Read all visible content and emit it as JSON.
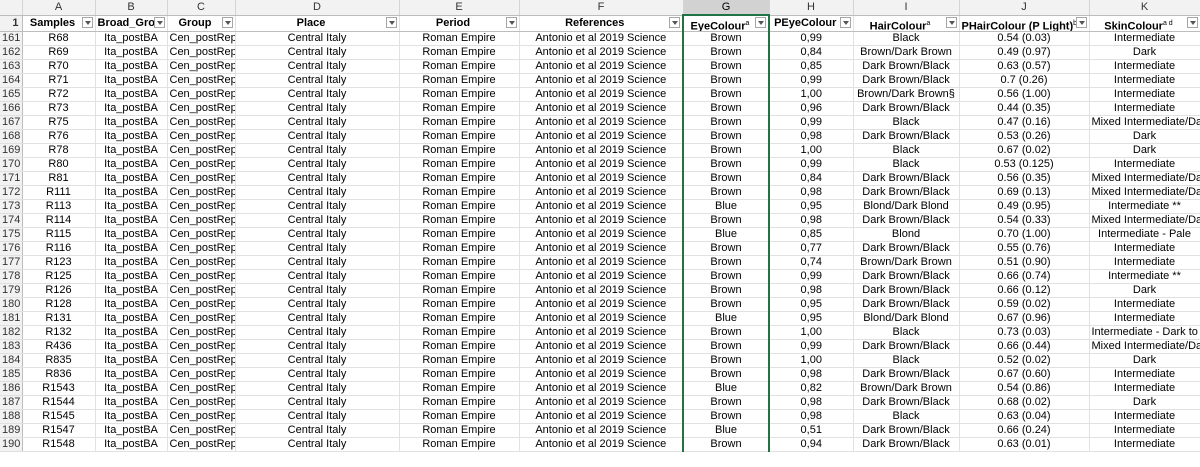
{
  "columns": [
    "A",
    "B",
    "C",
    "D",
    "E",
    "F",
    "G",
    "H",
    "I",
    "J",
    "K"
  ],
  "headers": [
    "Samples",
    "Broad_Gro",
    "Group",
    "Place",
    "Period",
    "References",
    "EyeColour",
    "PEyeColour",
    "HairColour",
    "PHairColour (P Light)",
    "SkinColour"
  ],
  "header_superscripts": [
    "",
    "",
    "",
    "",
    "",
    "",
    "a",
    "",
    "a",
    "b",
    "a d"
  ],
  "header_row_number": "1",
  "rows": [
    [
      "161",
      "R68",
      "Ita_postBA",
      "Cen_postRep",
      "Central Italy",
      "Roman Empire",
      "Antonio et al 2019 Science",
      "Brown",
      "0,99",
      "Black",
      "0.54 (0.03)",
      "Intermediate"
    ],
    [
      "162",
      "R69",
      "Ita_postBA",
      "Cen_postRep",
      "Central Italy",
      "Roman Empire",
      "Antonio et al 2019 Science",
      "Brown",
      "0,84",
      "Brown/Dark Brown",
      "0.49 (0.97)",
      "Dark"
    ],
    [
      "163",
      "R70",
      "Ita_postBA",
      "Cen_postRep",
      "Central Italy",
      "Roman Empire",
      "Antonio et al 2019 Science",
      "Brown",
      "0,85",
      "Dark Brown/Black",
      "0.63 (0.57)",
      "Intermediate"
    ],
    [
      "164",
      "R71",
      "Ita_postBA",
      "Cen_postRep",
      "Central Italy",
      "Roman Empire",
      "Antonio et al 2019 Science",
      "Brown",
      "0,99",
      "Dark Brown/Black",
      "0.7 (0.26)",
      "Intermediate"
    ],
    [
      "165",
      "R72",
      "Ita_postBA",
      "Cen_postRep",
      "Central Italy",
      "Roman Empire",
      "Antonio et al 2019 Science",
      "Brown",
      "1,00",
      "Brown/Dark Brown§",
      "0.56 (1.00)",
      "Intermediate"
    ],
    [
      "166",
      "R73",
      "Ita_postBA",
      "Cen_postRep",
      "Central Italy",
      "Roman Empire",
      "Antonio et al 2019 Science",
      "Brown",
      "0,96",
      "Dark Brown/Black",
      "0.44 (0.35)",
      "Intermediate"
    ],
    [
      "167",
      "R75",
      "Ita_postBA",
      "Cen_postRep",
      "Central Italy",
      "Roman Empire",
      "Antonio et al 2019 Science",
      "Brown",
      "0,99",
      "Black",
      "0.47 (0.16)",
      "Mixed Intermediate/Dark"
    ],
    [
      "168",
      "R76",
      "Ita_postBA",
      "Cen_postRep",
      "Central Italy",
      "Roman Empire",
      "Antonio et al 2019 Science",
      "Brown",
      "0,98",
      "Dark Brown/Black",
      "0.53 (0.26)",
      "Dark"
    ],
    [
      "169",
      "R78",
      "Ita_postBA",
      "Cen_postRep",
      "Central Italy",
      "Roman Empire",
      "Antonio et al 2019 Science",
      "Brown",
      "1,00",
      "Black",
      "0.67 (0.02)",
      "Dark"
    ],
    [
      "170",
      "R80",
      "Ita_postBA",
      "Cen_postRep",
      "Central Italy",
      "Roman Empire",
      "Antonio et al 2019 Science",
      "Brown",
      "0,99",
      "Black",
      "0.53 (0.125)",
      "Intermediate"
    ],
    [
      "171",
      "R81",
      "Ita_postBA",
      "Cen_postRep",
      "Central Italy",
      "Roman Empire",
      "Antonio et al 2019 Science",
      "Brown",
      "0,84",
      "Dark Brown/Black",
      "0.56 (0.35)",
      "Mixed Intermediate/Dark"
    ],
    [
      "172",
      "R111",
      "Ita_postBA",
      "Cen_postRep",
      "Central Italy",
      "Roman Empire",
      "Antonio et al 2019 Science",
      "Brown",
      "0,98",
      "Dark Brown/Black",
      "0.69 (0.13)",
      "Mixed Intermediate/Dark"
    ],
    [
      "173",
      "R113",
      "Ita_postBA",
      "Cen_postRep",
      "Central Italy",
      "Roman Empire",
      "Antonio et al 2019 Science",
      "Blue",
      "0,95",
      "Blond/Dark Blond",
      "0.49 (0.95)",
      "Intermediate **"
    ],
    [
      "174",
      "R114",
      "Ita_postBA",
      "Cen_postRep",
      "Central Italy",
      "Roman Empire",
      "Antonio et al 2019 Science",
      "Brown",
      "0,98",
      "Dark Brown/Black",
      "0.54 (0.33)",
      "Mixed Intermediate/Dark"
    ],
    [
      "175",
      "R115",
      "Ita_postBA",
      "Cen_postRep",
      "Central Italy",
      "Roman Empire",
      "Antonio et al 2019 Science",
      "Blue",
      "0,85",
      "Blond",
      "0.70 (1.00)",
      "Intermediate - Pale"
    ],
    [
      "176",
      "R116",
      "Ita_postBA",
      "Cen_postRep",
      "Central Italy",
      "Roman Empire",
      "Antonio et al 2019 Science",
      "Brown",
      "0,77",
      "Dark Brown/Black",
      "0.55 (0.76)",
      "Intermediate"
    ],
    [
      "177",
      "R123",
      "Ita_postBA",
      "Cen_postRep",
      "Central Italy",
      "Roman Empire",
      "Antonio et al 2019 Science",
      "Brown",
      "0,74",
      "Brown/Dark Brown",
      "0.51 (0.90)",
      "Intermediate"
    ],
    [
      "178",
      "R125",
      "Ita_postBA",
      "Cen_postRep",
      "Central Italy",
      "Roman Empire",
      "Antonio et al 2019 Science",
      "Brown",
      "0,99",
      "Dark Brown/Black",
      "0.66 (0.74)",
      "Intermediate **"
    ],
    [
      "179",
      "R126",
      "Ita_postBA",
      "Cen_postRep",
      "Central Italy",
      "Roman Empire",
      "Antonio et al 2019 Science",
      "Brown",
      "0,98",
      "Dark Brown/Black",
      "0.66 (0.12)",
      "Dark"
    ],
    [
      "180",
      "R128",
      "Ita_postBA",
      "Cen_postRep",
      "Central Italy",
      "Roman Empire",
      "Antonio et al 2019 Science",
      "Brown",
      "0,95",
      "Dark Brown/Black",
      "0.59 (0.02)",
      "Intermediate"
    ],
    [
      "181",
      "R131",
      "Ita_postBA",
      "Cen_postRep",
      "Central Italy",
      "Roman Empire",
      "Antonio et al 2019 Science",
      "Blue",
      "0,95",
      "Blond/Dark Blond",
      "0.67 (0.96)",
      "Intermediate"
    ],
    [
      "182",
      "R132",
      "Ita_postBA",
      "Cen_postRep",
      "Central Italy",
      "Roman Empire",
      "Antonio et al 2019 Science",
      "Brown",
      "1,00",
      "Black",
      "0.73 (0.03)",
      "Intermediate - Dark to Black"
    ],
    [
      "183",
      "R436",
      "Ita_postBA",
      "Cen_postRep",
      "Central Italy",
      "Roman Empire",
      "Antonio et al 2019 Science",
      "Brown",
      "0,99",
      "Dark Brown/Black",
      "0.66 (0.44)",
      "Mixed Intermediate/Dark"
    ],
    [
      "184",
      "R835",
      "Ita_postBA",
      "Cen_postRep",
      "Central Italy",
      "Roman Empire",
      "Antonio et al 2019 Science",
      "Brown",
      "1,00",
      "Black",
      "0.52 (0.02)",
      "Dark"
    ],
    [
      "185",
      "R836",
      "Ita_postBA",
      "Cen_postRep",
      "Central Italy",
      "Roman Empire",
      "Antonio et al 2019 Science",
      "Brown",
      "0,98",
      "Dark Brown/Black",
      "0.67 (0.60)",
      "Intermediate"
    ],
    [
      "186",
      "R1543",
      "Ita_postBA",
      "Cen_postRep",
      "Central Italy",
      "Roman Empire",
      "Antonio et al 2019 Science",
      "Blue",
      "0,82",
      "Brown/Dark Brown",
      "0.54 (0.86)",
      "Intermediate"
    ],
    [
      "187",
      "R1544",
      "Ita_postBA",
      "Cen_postRep",
      "Central Italy",
      "Roman Empire",
      "Antonio et al 2019 Science",
      "Brown",
      "0,98",
      "Dark Brown/Black",
      "0.68 (0.02)",
      "Dark"
    ],
    [
      "188",
      "R1545",
      "Ita_postBA",
      "Cen_postRep",
      "Central Italy",
      "Roman Empire",
      "Antonio et al 2019 Science",
      "Brown",
      "0,98",
      "Black",
      "0.63 (0.04)",
      "Intermediate"
    ],
    [
      "189",
      "R1547",
      "Ita_postBA",
      "Cen_postRep",
      "Central Italy",
      "Roman Empire",
      "Antonio et al 2019 Science",
      "Blue",
      "0,51",
      "Dark Brown/Black",
      "0.66 (0.24)",
      "Intermediate"
    ],
    [
      "190",
      "R1548",
      "Ita_postBA",
      "Cen_postRep",
      "Central Italy",
      "Roman Empire",
      "Antonio et al 2019 Science",
      "Brown",
      "0,94",
      "Dark Brown/Black",
      "0.63 (0.01)",
      "Intermediate"
    ]
  ],
  "selected_column": "G",
  "colors": {
    "grid": "#e1e1e1",
    "header_bg": "#f2f2f2",
    "selection": "#217346"
  },
  "icons": {
    "filter": "filter-dropdown-icon"
  }
}
